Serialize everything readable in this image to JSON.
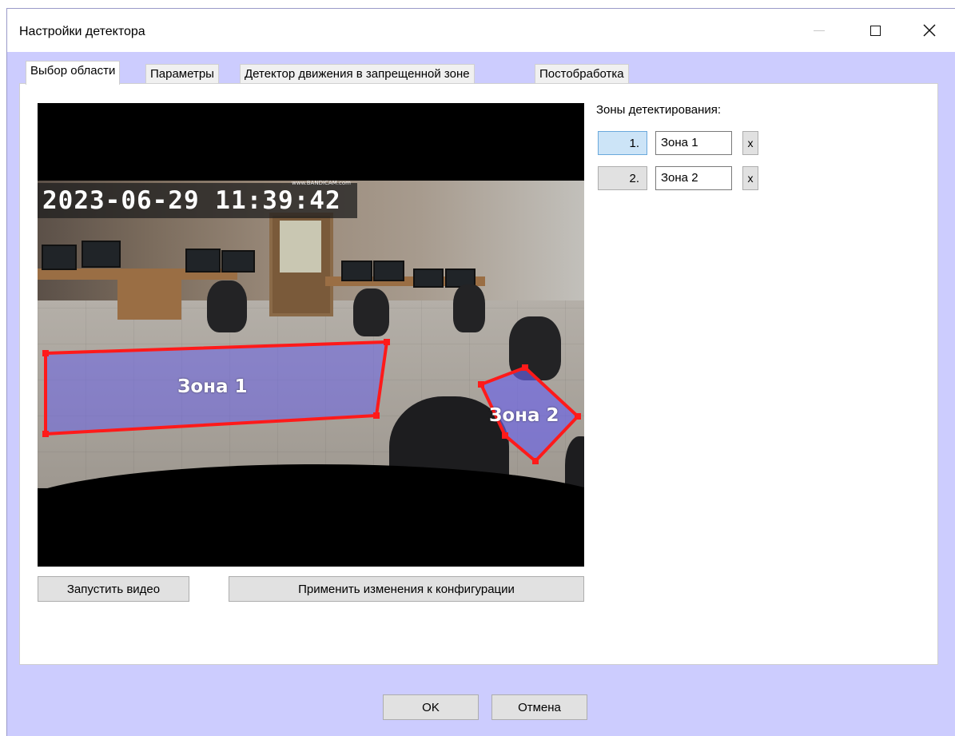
{
  "window": {
    "title": "Настройки детектора",
    "minimize_icon": "minimize-icon",
    "maximize_icon": "maximize-icon",
    "close_icon": "close-icon"
  },
  "tabs": [
    {
      "label": "Выбор области",
      "active": true
    },
    {
      "label": "Параметры",
      "active": false
    },
    {
      "label": "Детектор движения в запрещенной зоне",
      "active": false
    },
    {
      "label": "Постобработка",
      "active": false
    }
  ],
  "video": {
    "timestamp": "2023-06-29 11:39:42",
    "watermark": "www.BANDICAM.com",
    "zone_color": "#ff1a1a",
    "zone_fill": "#6a63e8"
  },
  "video_controls": {
    "start_label": "Запустить видео",
    "apply_label": "Применить изменения к конфигурации"
  },
  "zones_panel": {
    "title": "Зоны детектирования:",
    "zones": [
      {
        "number": "1.",
        "name": "Зона 1",
        "delete_label": "x",
        "selected": true
      },
      {
        "number": "2.",
        "name": "Зона 2",
        "delete_label": "x",
        "selected": false
      }
    ]
  },
  "footer": {
    "ok_label": "OK",
    "cancel_label": "Отмена"
  }
}
